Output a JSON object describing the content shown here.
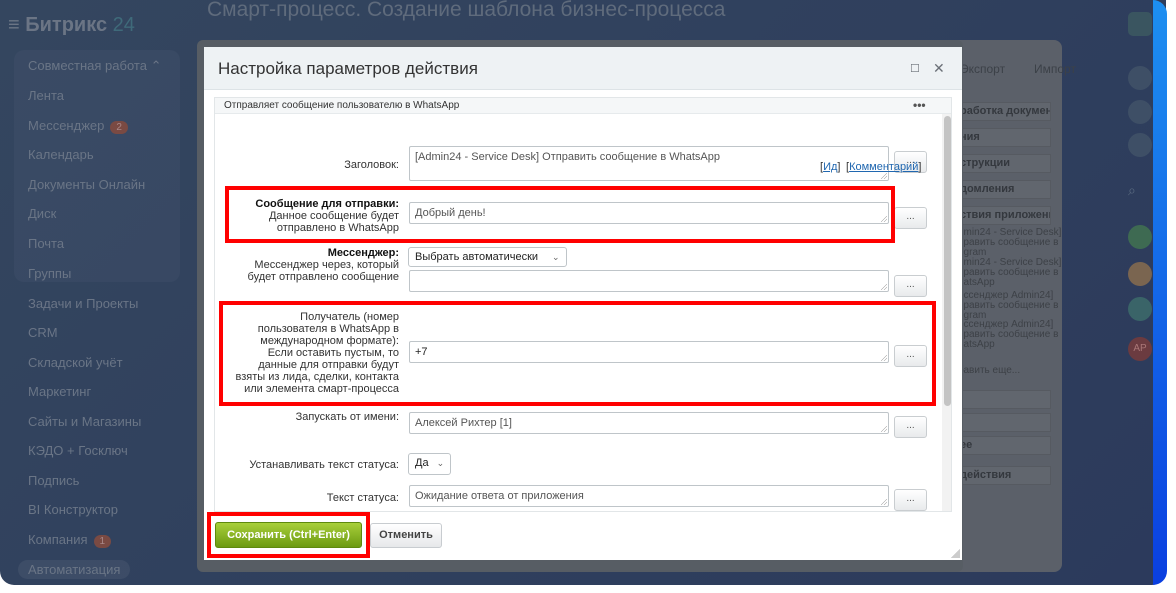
{
  "app": {
    "logo": "Битрикс",
    "logo_num": "24",
    "page_title": "Смарт-процесс. Создание шаблона бизнес-процесса"
  },
  "sidebar": {
    "group": "Совместная работа",
    "items": [
      {
        "label": "Лента"
      },
      {
        "label": "Мессенджер",
        "badge": "2"
      },
      {
        "label": "Календарь"
      },
      {
        "label": "Документы Онлайн"
      },
      {
        "label": "Диск"
      },
      {
        "label": "Почта"
      },
      {
        "label": "Группы"
      },
      {
        "label": "Задачи и Проекты"
      },
      {
        "label": "CRM"
      },
      {
        "label": "Складской учёт"
      },
      {
        "label": "Маркетинг"
      },
      {
        "label": "Сайты и Магазины"
      },
      {
        "label": "КЭДО + Госключ"
      },
      {
        "label": "Подпись"
      },
      {
        "label": "BI Конструктор"
      },
      {
        "label": "Компания",
        "badge": "1"
      },
      {
        "label": "Автоматизация"
      }
    ]
  },
  "right_panel": {
    "export": "Экспорт",
    "import": "Импорт",
    "rows": [
      "работка документа",
      "ния",
      "струкции",
      "домления",
      "ствия приложений"
    ],
    "subs": [
      "dmin24 - Service Desk]\nправить сообщение в\negram",
      "dmin24 - Service Desk]\nправить сообщение в\nhatsApp",
      "ессенджер Admin24]\nправить сообщение в\negram",
      "ессенджер Admin24]\nправить сообщение в\nhatsApp",
      "бавить еще..."
    ],
    "rows2": [
      "",
      "",
      "ее",
      "действия"
    ],
    "avatar_initials": "АР"
  },
  "dialog": {
    "title": "Настройка параметров действия",
    "description": "Отправляет сообщение пользователю в WhatsApp",
    "fields": {
      "title_label": "Заголовок:",
      "title_value": "[Admin24 - Service Desk] Отправить сообщение в WhatsApp",
      "id_link": "Ид",
      "comment_link": "Комментарий",
      "message_label": "Сообщение для отправки:",
      "message_hint": "Данное сообщение будет\nотправлено в WhatsApp",
      "message_value": "Добрый день!",
      "messenger_label": "Мессенджер:",
      "messenger_hint": "Мессенджер через, который\nбудет отправлено сообщение",
      "messenger_select": "Выбрать автоматически",
      "recipient_label": "Получатель (номер\nпользователя в WhatsApp в\nмеждународном формате):\nЕсли оставить пустым, то\nданные для отправки будут\nвзяты из лида, сделки, контакта\nили элемента смарт-процесса",
      "recipient_value": "+7",
      "run_as_label": "Запускать от имени:",
      "run_as_value": "Алексей Рихтер [1]",
      "set_status_label": "Устанавливать текст статуса:",
      "set_status_value": "Да",
      "status_text_label": "Текст статуса:",
      "status_text_value": "Ожидание ответа от приложения"
    },
    "more_label": "...",
    "save": "Сохранить (Ctrl+Enter)",
    "cancel": "Отменить"
  }
}
